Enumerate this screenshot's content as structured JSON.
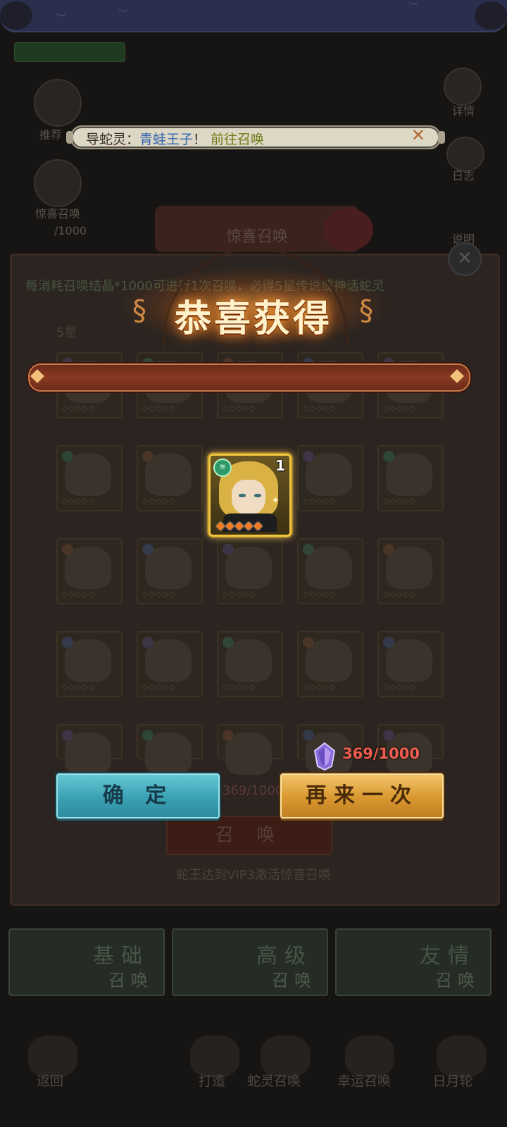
{
  "background": {
    "side_left": [
      {
        "label": "推荐"
      },
      {
        "label": "惊喜召唤",
        "sub": "/1000"
      }
    ],
    "side_right": [
      {
        "label": "详情"
      },
      {
        "label": "日志"
      },
      {
        "label": "说明"
      }
    ],
    "panel_title": "惊喜召唤",
    "rule_text": "每消耗召唤结晶*1000可进行1次召唤，必得5星传说或神话蛇灵",
    "star_label": "5星",
    "summon_cost": "369/1000",
    "summon_button": "召 唤",
    "vip_hint": "蛇王达到VIP3激活惊喜召唤",
    "tabs": [
      {
        "title": "基础",
        "sub": "召唤"
      },
      {
        "title": "高级",
        "sub": "召唤"
      },
      {
        "title": "友情",
        "sub": "召唤"
      }
    ],
    "bottom_nav": [
      {
        "label": "返回"
      },
      {
        "label": "打造"
      },
      {
        "label": "蛇灵召唤"
      },
      {
        "label": "幸运召唤"
      },
      {
        "label": "日月轮"
      }
    ]
  },
  "notice": {
    "prefix": "导蛇灵：",
    "name": "青蛙王子",
    "exclaim": "！",
    "link": "前往召唤",
    "close_icon": "close-x-icon"
  },
  "reward": {
    "title": "恭喜获得",
    "hero": {
      "count": "1",
      "stars": 5,
      "stars_text": "◆◆◆◆◆",
      "element_icon": "wind-element-icon"
    },
    "crystal": {
      "icon": "crystal-icon",
      "count": "369/1000"
    }
  },
  "buttons": {
    "confirm": "确 定",
    "again": "再来一次"
  },
  "colors": {
    "title_glow": "#f29a3b",
    "confirm_btn": "#3aa1b3",
    "again_btn": "#d9982f",
    "crystal_count": "#f05d4f",
    "notice_name": "#2e64ae",
    "notice_link": "#6f7c17"
  }
}
